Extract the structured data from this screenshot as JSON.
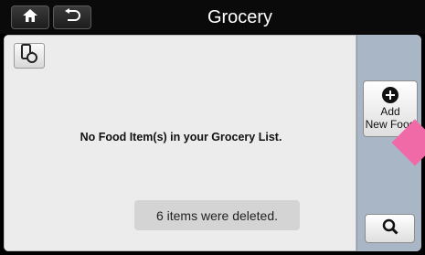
{
  "header": {
    "title": "Grocery",
    "home_icon": "home-icon",
    "back_icon": "back-arrow-icon"
  },
  "main": {
    "sync_icon": "device-sync-icon",
    "empty_message": "No Food Item(s) in your Grocery List.",
    "toast": "6 items were deleted."
  },
  "sidebar": {
    "add_label_line1": "Add",
    "add_label_line2": "New Food",
    "add_icon": "plus-circle-icon",
    "search_icon": "search-icon"
  },
  "colors": {
    "topbar": "#0a0a0a",
    "content_bg": "#ececec",
    "sidepanel": "#a9b6c6",
    "accent_pink": "#f06aa8"
  }
}
